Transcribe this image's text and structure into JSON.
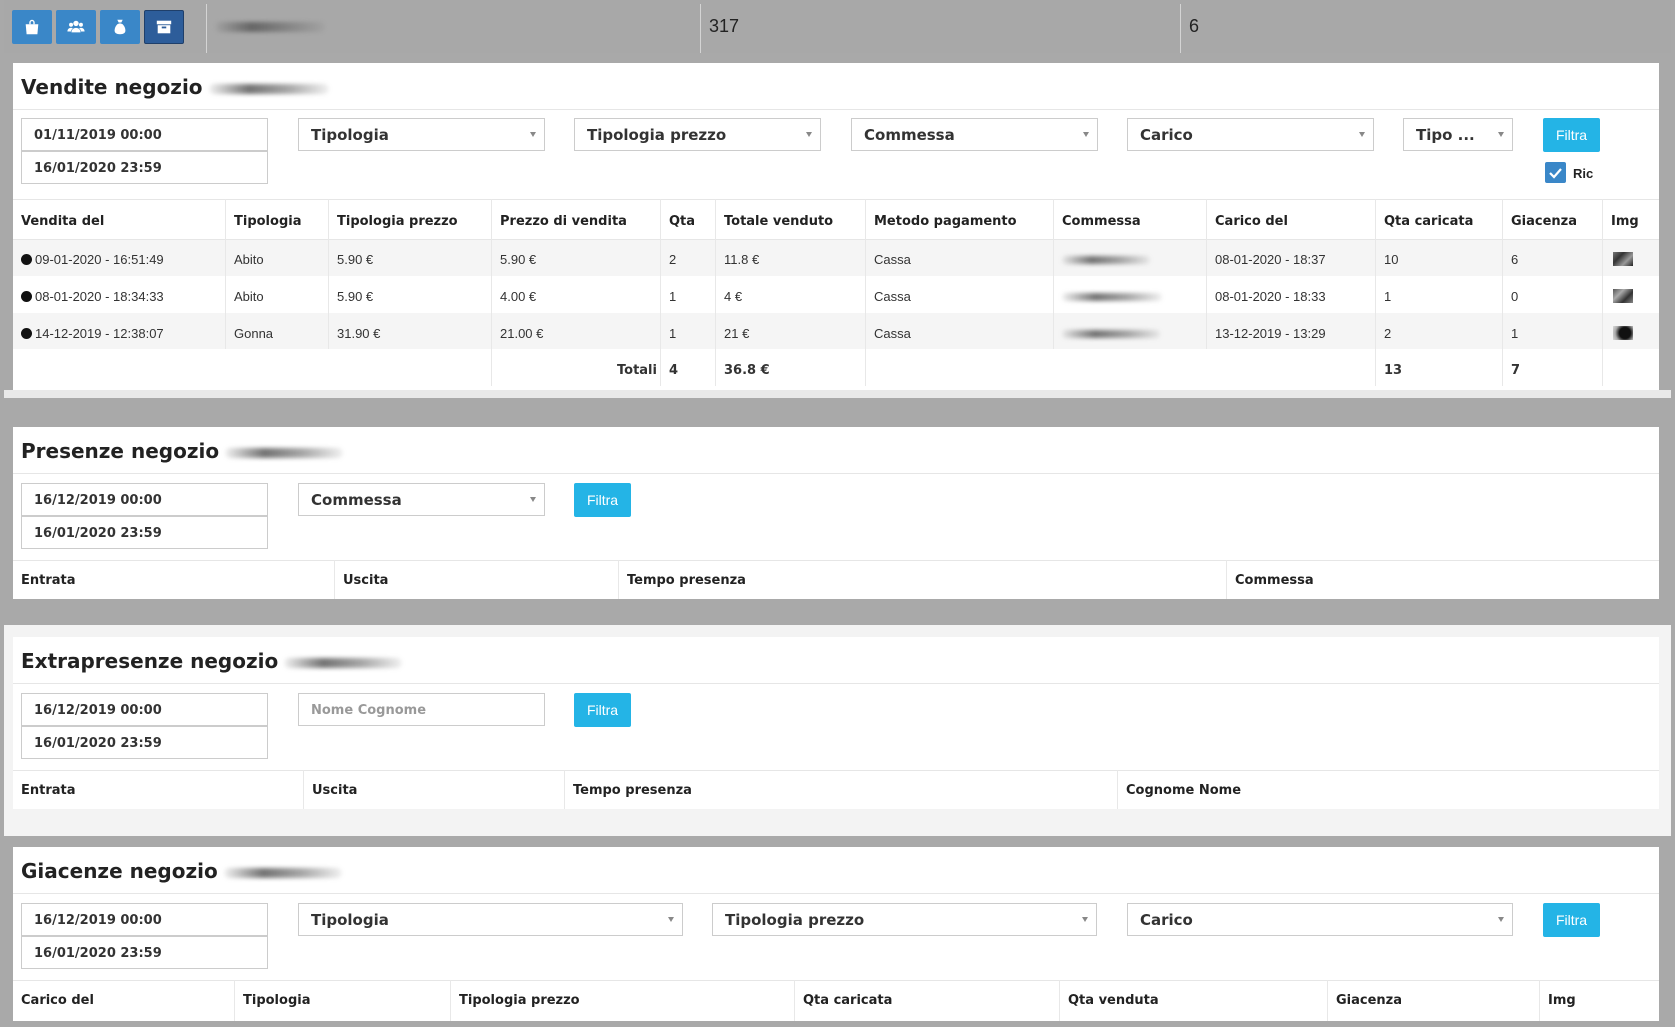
{
  "topbar": {
    "buttons": [
      {
        "icon": "shopping-bag-icon"
      },
      {
        "icon": "users-icon"
      },
      {
        "icon": "money-bag-icon"
      },
      {
        "icon": "archive-icon",
        "active": true
      }
    ],
    "value1": "317",
    "value2": "6"
  },
  "vendite": {
    "title": "Vendite negozio",
    "date_from": "01/11/2019 00:00",
    "date_to": "16/01/2020 23:59",
    "filters": {
      "tipologia": "Tipologia",
      "tipologia_prezzo": "Tipologia prezzo",
      "commessa": "Commessa",
      "carico": "Carico",
      "tipo": "Tipo ..."
    },
    "filter_label": "Filtra",
    "check_label": "Ric",
    "headers": [
      "Vendita del",
      "Tipologia",
      "Tipologia prezzo",
      "Prezzo di vendita",
      "Qta",
      "Totale venduto",
      "Metodo pagamento",
      "Commessa",
      "Carico del",
      "Qta caricata",
      "Giacenza",
      "Img"
    ],
    "rows": [
      {
        "vendita": "09-01-2020 - 16:51:49",
        "tipologia": "Abito",
        "tip_prezzo": "5.90 €",
        "prezzo": "5.90 €",
        "qta": "2",
        "totale": "11.8 €",
        "metodo": "Cassa",
        "carico": "08-01-2020 - 18:37",
        "qta_caricata": "10",
        "giacenza": "6"
      },
      {
        "vendita": "08-01-2020 - 18:34:33",
        "tipologia": "Abito",
        "tip_prezzo": "5.90 €",
        "prezzo": "4.00 €",
        "qta": "1",
        "totale": "4 €",
        "metodo": "Cassa",
        "carico": "08-01-2020 - 18:33",
        "qta_caricata": "1",
        "giacenza": "0"
      },
      {
        "vendita": "14-12-2019 - 12:38:07",
        "tipologia": "Gonna",
        "tip_prezzo": "31.90 €",
        "prezzo": "21.00 €",
        "qta": "1",
        "totale": "21 €",
        "metodo": "Cassa",
        "carico": "13-12-2019 - 13:29",
        "qta_caricata": "2",
        "giacenza": "1"
      }
    ],
    "totals": {
      "label": "Totali",
      "qta": "4",
      "totale": "36.8 €",
      "qta_caricata": "13",
      "giacenza": "7"
    }
  },
  "presenze": {
    "title": "Presenze negozio",
    "date_from": "16/12/2019 00:00",
    "date_to": "16/01/2020 23:59",
    "commessa": "Commessa",
    "filter_label": "Filtra",
    "headers": [
      "Entrata",
      "Uscita",
      "Tempo presenza",
      "Commessa"
    ]
  },
  "extrapresenze": {
    "title": "Extrapresenze negozio",
    "date_from": "16/12/2019 00:00",
    "date_to": "16/01/2020 23:59",
    "name_placeholder": "Nome Cognome",
    "filter_label": "Filtra",
    "headers": [
      "Entrata",
      "Uscita",
      "Tempo presenza",
      "Cognome Nome"
    ]
  },
  "giacenze": {
    "title": "Giacenze negozio",
    "date_from": "16/12/2019 00:00",
    "date_to": "16/01/2020 23:59",
    "filters": {
      "tipologia": "Tipologia",
      "tipologia_prezzo": "Tipologia prezzo",
      "carico": "Carico"
    },
    "filter_label": "Filtra",
    "headers": [
      "Carico del",
      "Tipologia",
      "Tipologia prezzo",
      "Qta caricata",
      "Qta venduta",
      "Giacenza",
      "Img"
    ]
  }
}
